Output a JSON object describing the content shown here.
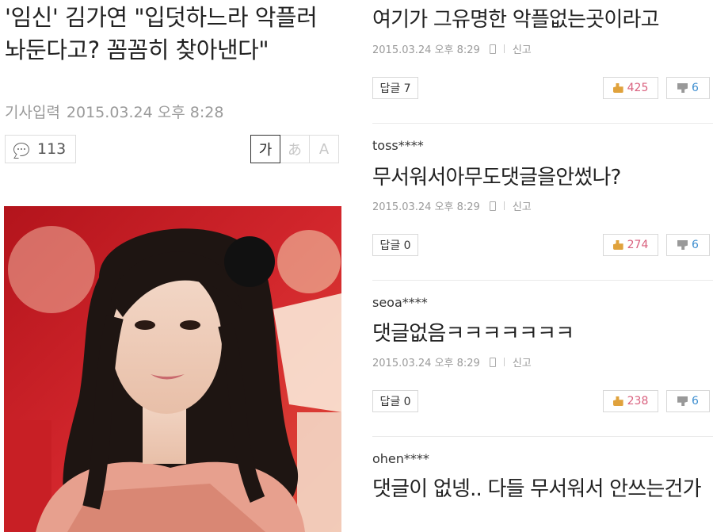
{
  "article": {
    "headline": "'임신' 김가연 \"입덧하느라 악플러 놔둔다고? 꼼꼼히 찾아낸다\"",
    "byline_label": "기사입력",
    "byline_datetime": "2015.03.24 오후 8:28",
    "comment_count": "113",
    "font_sizes": [
      "가",
      "あ",
      "A"
    ]
  },
  "comments": [
    {
      "user": "",
      "text": "여기가 그유명한 악플없는곳이라고",
      "datetime": "2015.03.24 오후 8:29",
      "report": "신고",
      "reply": "답글 7",
      "likes": "425",
      "dislikes": "6"
    },
    {
      "user": "toss****",
      "text": "무서워서아무도댓글을안썼나?",
      "datetime": "2015.03.24 오후 8:29",
      "report": "신고",
      "reply": "답글 0",
      "likes": "274",
      "dislikes": "6"
    },
    {
      "user": "seoa****",
      "text": "댓글없음ㅋㅋㅋㅋㅋㅋㅋ",
      "datetime": "2015.03.24 오후 8:29",
      "report": "신고",
      "reply": "답글 0",
      "likes": "238",
      "dislikes": "6"
    },
    {
      "user": "ohen****",
      "text": "댓글이 없넹.. 다들 무서워서 안쓰는건가"
    }
  ],
  "colors": {
    "like": "#d9607e",
    "dislike": "#3f8fd0",
    "meta": "#9a9a9a"
  }
}
